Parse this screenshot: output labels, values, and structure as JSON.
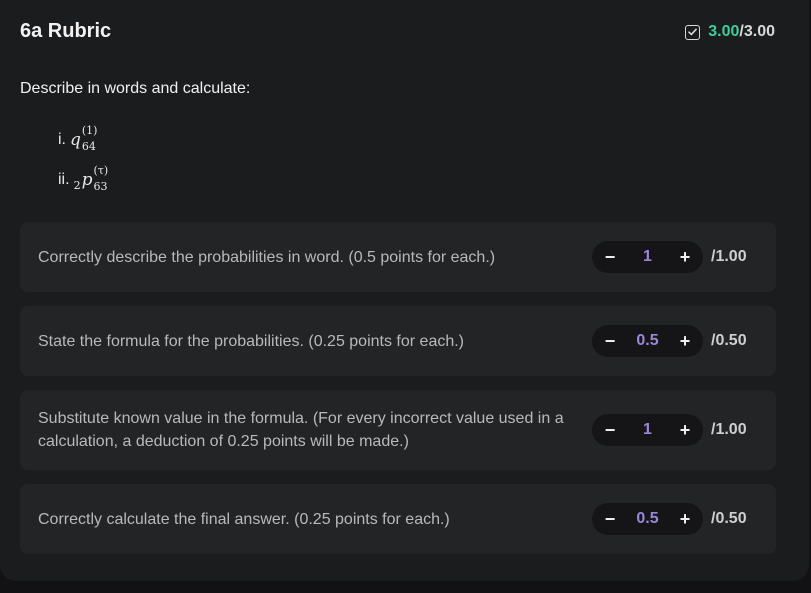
{
  "header": {
    "title": "6a Rubric",
    "score_earned": "3.00",
    "score_total": "/3.00"
  },
  "prompt": "Describe in words and calculate:",
  "math_items": [
    {
      "label": "i.",
      "base": "q",
      "sup": "(1)",
      "sub": "64",
      "prefix": ""
    },
    {
      "label": "ii.",
      "base": "p",
      "sup": "(τ)",
      "sub": "63",
      "prefix": "2"
    }
  ],
  "criteria": [
    {
      "text": "Correctly describe the probabilities in word. (0.5 points for each.)",
      "value": "1",
      "max": "/1.00",
      "minus": "−",
      "plus": "+"
    },
    {
      "text": "State the formula for the probabilities. (0.25 points for each.)",
      "value": "0.5",
      "max": "/0.50",
      "minus": "−",
      "plus": "+"
    },
    {
      "text": "Substitute known value in the formula. (For every incorrect value used in a calculation, a deduction of 0.25 points will be made.)",
      "value": "1",
      "max": "/1.00",
      "minus": "−",
      "plus": "+"
    },
    {
      "text": "Correctly calculate the final answer. (0.25 points for each.)",
      "value": "0.5",
      "max": "/0.50",
      "minus": "−",
      "plus": "+"
    }
  ],
  "colors": {
    "accent_score": "#3ccf9a",
    "stepper_value": "#9b87d9"
  },
  "icons": {
    "score": "checkbox-checked-icon",
    "decrement": "minus-icon",
    "increment": "plus-icon"
  }
}
